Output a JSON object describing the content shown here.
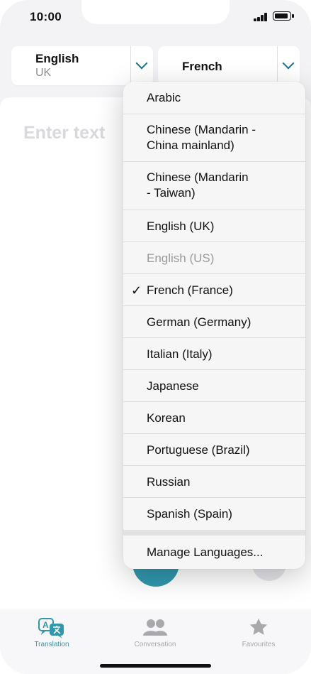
{
  "status_bar": {
    "time": "10:00"
  },
  "source_language": {
    "name": "English",
    "region": "UK"
  },
  "target_language": {
    "name": "French"
  },
  "input": {
    "placeholder": "Enter text"
  },
  "dropdown": {
    "options": [
      {
        "label": "Arabic",
        "selected": false,
        "disabled": false
      },
      {
        "label": "Chinese (Mandarin -\nChina mainland)",
        "selected": false,
        "disabled": false
      },
      {
        "label": "Chinese (Mandarin\n- Taiwan)",
        "selected": false,
        "disabled": false
      },
      {
        "label": "English (UK)",
        "selected": false,
        "disabled": false
      },
      {
        "label": "English (US)",
        "selected": false,
        "disabled": true
      },
      {
        "label": "French (France)",
        "selected": true,
        "disabled": false
      },
      {
        "label": "German (Germany)",
        "selected": false,
        "disabled": false
      },
      {
        "label": "Italian (Italy)",
        "selected": false,
        "disabled": false
      },
      {
        "label": "Japanese",
        "selected": false,
        "disabled": false
      },
      {
        "label": "Korean",
        "selected": false,
        "disabled": false
      },
      {
        "label": "Portuguese (Brazil)",
        "selected": false,
        "disabled": false
      },
      {
        "label": "Russian",
        "selected": false,
        "disabled": false
      },
      {
        "label": "Spanish (Spain)",
        "selected": false,
        "disabled": false
      }
    ],
    "checkmark": "✓",
    "manage_label": "Manage Languages..."
  },
  "tabs": [
    {
      "label": "Translation",
      "icon": "translate-icon",
      "active": true
    },
    {
      "label": "Conversation",
      "icon": "people-icon",
      "active": false
    },
    {
      "label": "Favourites",
      "icon": "star-icon",
      "active": false
    }
  ],
  "colors": {
    "accent": "#3197ad",
    "chevron": "#1f6f89",
    "inactive": "#a8a8ad"
  }
}
